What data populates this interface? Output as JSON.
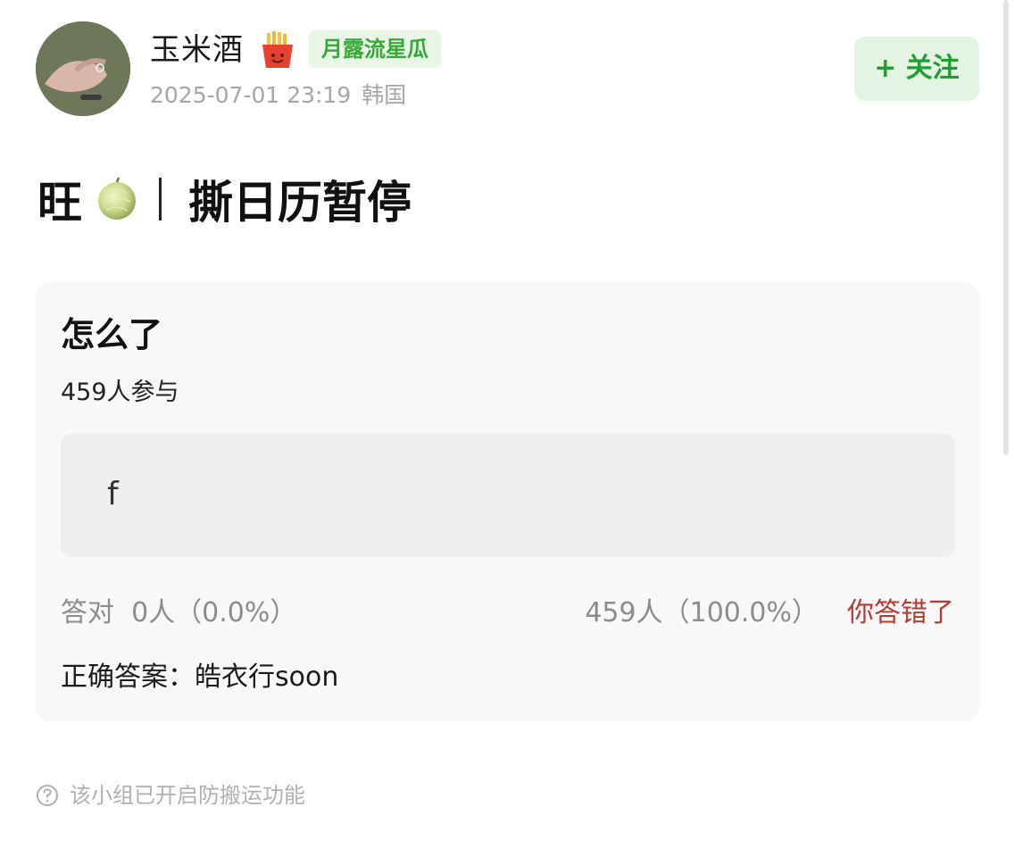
{
  "post": {
    "author": {
      "name": "玉米酒",
      "group_tag": "月露流星瓜",
      "timestamp": "2025-07-01 23:19",
      "location": "韩国"
    },
    "follow_label": "+ 关注",
    "title_prefix": "旺",
    "title_text": "撕日历暂停"
  },
  "quiz": {
    "question": "怎么了",
    "participants": "459人参与",
    "options": [
      {
        "label": "f"
      }
    ],
    "stats": {
      "correct_label": "答对",
      "correct_value": "0人（0.0%）",
      "wrong_value": "459人（100.0%）",
      "wrong_flag": "你答错了"
    },
    "answer_label": "正确答案：",
    "answer_value": "皓衣行soon"
  },
  "footer": {
    "notice": "该小组已开启防搬运功能"
  },
  "colors": {
    "accent_green": "#1f9e32",
    "tag_green": "#37a83a",
    "wrong_red": "#b83a33",
    "muted_gray": "#8c8c8c"
  },
  "icons": [
    "avatar-photo",
    "fries-emoji-icon",
    "melon-emoji-icon",
    "help-circle-icon"
  ]
}
